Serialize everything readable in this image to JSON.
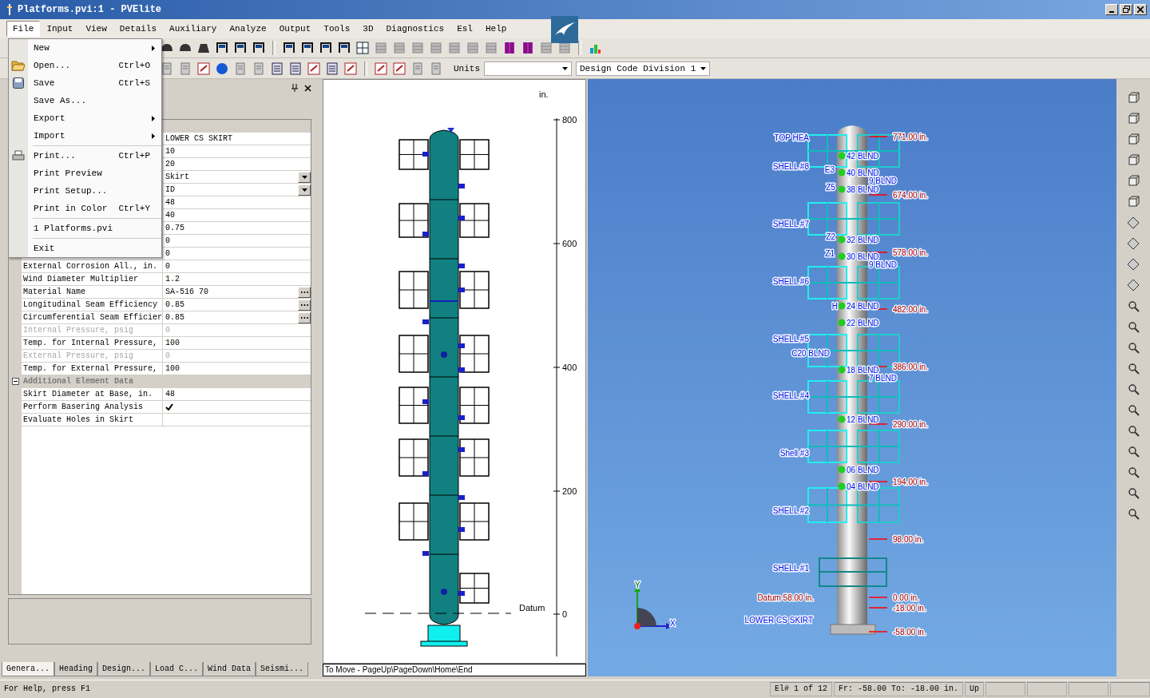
{
  "window": {
    "title": "Platforms.pvi:1 - PVElite"
  },
  "menu_bar": [
    {
      "label": "File",
      "selected": true
    },
    {
      "label": "Input",
      "selected": false
    },
    {
      "label": "View",
      "selected": false
    },
    {
      "label": "Details",
      "selected": false
    },
    {
      "label": "Auxiliary",
      "selected": false
    },
    {
      "label": "Analyze",
      "selected": false
    },
    {
      "label": "Output",
      "selected": false
    },
    {
      "label": "Tools",
      "selected": false
    },
    {
      "label": "3D",
      "selected": false
    },
    {
      "label": "Diagnostics",
      "selected": false
    },
    {
      "label": "Esl",
      "selected": false
    },
    {
      "label": "Help",
      "selected": false
    }
  ],
  "file_menu": [
    {
      "kind": "item",
      "label": "New",
      "submenu": true
    },
    {
      "kind": "item",
      "label": "Open...",
      "shortcut": "Ctrl+O"
    },
    {
      "kind": "item",
      "label": "Save",
      "shortcut": "Ctrl+S"
    },
    {
      "kind": "item",
      "label": "Save As..."
    },
    {
      "kind": "item",
      "label": "Export",
      "submenu": true
    },
    {
      "kind": "item",
      "label": "Import",
      "submenu": true
    },
    {
      "kind": "separator"
    },
    {
      "kind": "item",
      "label": "Print...",
      "shortcut": "Ctrl+P"
    },
    {
      "kind": "item",
      "label": "Print Preview"
    },
    {
      "kind": "item",
      "label": "Print Setup..."
    },
    {
      "kind": "item",
      "label": "Print in Color",
      "shortcut": "Ctrl+Y"
    },
    {
      "kind": "separator"
    },
    {
      "kind": "item",
      "label": "1 Platforms.pvi"
    },
    {
      "kind": "separator"
    },
    {
      "kind": "item",
      "label": "Exit"
    }
  ],
  "toolbar": {
    "units_label": "Units",
    "code_select": "Design Code Division 1"
  },
  "property_grid": [
    {
      "kind": "category"
    },
    {
      "kind": "text",
      "value": "LOWER CS SKIRT"
    },
    {
      "kind": "text",
      "value": "10"
    },
    {
      "kind": "text",
      "value": "20"
    },
    {
      "kind": "dropdown",
      "value": "Skirt"
    },
    {
      "kind": "dropdown",
      "value": "ID"
    },
    {
      "kind": "text",
      "value": "48"
    },
    {
      "kind": "text",
      "value": "40"
    },
    {
      "kind": "text",
      "value": "0.75"
    },
    {
      "kind": "text",
      "value": "0"
    },
    {
      "kind": "text",
      "value": "0"
    },
    {
      "kind": "text",
      "name": "External Corrosion All., in.",
      "value": "0"
    },
    {
      "kind": "text",
      "name": "Wind Diameter Multiplier",
      "value": "1.2"
    },
    {
      "kind": "browse",
      "name": "Material Name",
      "value": "SA-516 70"
    },
    {
      "kind": "browse",
      "name": "Longitudinal Seam Efficiency",
      "value": "0.85"
    },
    {
      "kind": "browse",
      "name": "Circumferential Seam Efficier",
      "value": "0.85"
    },
    {
      "kind": "text",
      "name": "Internal Pressure, psig",
      "value": "0",
      "disabled": true
    },
    {
      "kind": "text",
      "name": "Temp. for Internal Pressure,",
      "value": "100"
    },
    {
      "kind": "text",
      "name": "External Pressure, psig",
      "value": "0",
      "disabled": true
    },
    {
      "kind": "text",
      "name": "Temp. for External Pressure,",
      "value": "100"
    },
    {
      "kind": "category",
      "name": "Additional Element Data",
      "expanded": true
    },
    {
      "kind": "text",
      "name": "Skirt Diameter at Base, in.",
      "value": "48"
    },
    {
      "kind": "check",
      "name": "Perform Basering Analysis",
      "checked": true
    },
    {
      "kind": "check",
      "name": "Evaluate Holes in Skirt",
      "checked": false
    }
  ],
  "tabs": [
    {
      "label": "Genera...",
      "selected": true
    },
    {
      "label": "Heading",
      "selected": false
    },
    {
      "label": "Design...",
      "selected": false
    },
    {
      "label": "Load C...",
      "selected": false
    },
    {
      "label": "Wind Data",
      "selected": false
    },
    {
      "label": "Seismi...",
      "selected": false
    }
  ],
  "elevation_view": {
    "unit": "in.",
    "scale_labels": [
      "800",
      "600",
      "400",
      "200",
      "0"
    ],
    "datum": "Datum",
    "hint": "To Move - PageUp\\PageDown\\Home\\End"
  },
  "model_view": {
    "shell_labels": [
      "TOP HEA",
      "SHELL #8",
      "SHELL #7",
      "SHELL #6",
      "SHELL #5",
      "C20 BLND",
      "SHELL #4",
      "Shell #3",
      "SHELL #2",
      "SHELL #1"
    ],
    "datum_label": "Datum 58.00 in.",
    "skirt_label": "LOWER CS SKIRT",
    "elevation_labels": [
      "771.00 in.",
      "674.00 in.",
      "578.00 in.",
      "482.00 in.",
      "386.00 in.",
      "290.00 in.",
      "194.00 in.",
      "98.00 in.",
      "0.00 in.",
      "-18.00 in.",
      "-58.00 in."
    ],
    "nozzle_labels": [
      "42 BLND",
      "40 BLND",
      "38 BLND",
      "32 BLND",
      "30 BLND",
      "24 BLND",
      "22 BLND",
      "18 BLND",
      "12 BLND",
      "06 BLND",
      "04 BLND"
    ],
    "side_labels": [
      "9 BLND",
      "9 BLND",
      "7 BLND"
    ],
    "tag_labels": [
      "E3",
      "Z5",
      "Z2",
      "Z1",
      "H"
    ],
    "axis_labels": [
      "Y",
      "X"
    ]
  },
  "status_bar": {
    "help": "For Help, press F1",
    "element": "El# 1 of 12",
    "range": "Fr: -58.00 To: -18.00 in.",
    "direction": "Up"
  }
}
